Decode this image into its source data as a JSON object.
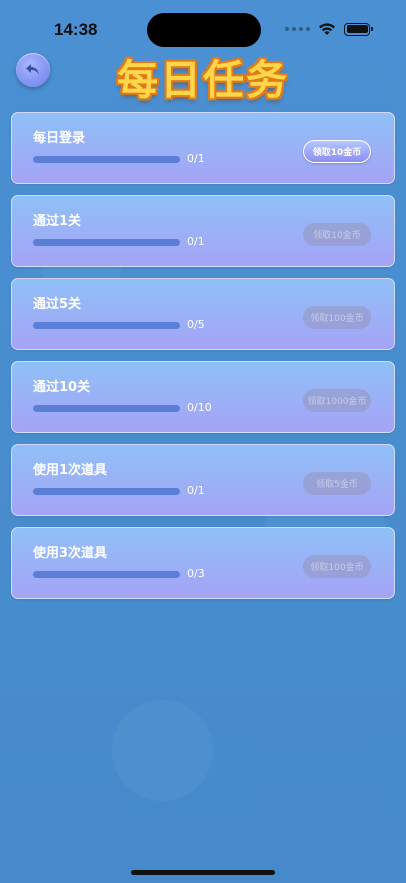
{
  "status_bar": {
    "time": "14:38"
  },
  "header": {
    "title": "每日任务"
  },
  "tasks": [
    {
      "name": "每日登录",
      "progress_text": "0/1",
      "progress": 0,
      "claim_label": "领取10金币",
      "claimable": true
    },
    {
      "name": "通过1关",
      "progress_text": "0/1",
      "progress": 0,
      "claim_label": "领取10金币",
      "claimable": false
    },
    {
      "name": "通过5关",
      "progress_text": "0/5",
      "progress": 0,
      "claim_label": "领取100金币",
      "claimable": false
    },
    {
      "name": "通过10关",
      "progress_text": "0/10",
      "progress": 0,
      "claim_label": "领取1000金币",
      "claimable": false
    },
    {
      "name": "使用1次道具",
      "progress_text": "0/1",
      "progress": 0,
      "claim_label": "领取5金币",
      "claimable": false
    },
    {
      "name": "使用3次道具",
      "progress_text": "0/3",
      "progress": 0,
      "claim_label": "领取100金币",
      "claimable": false
    }
  ],
  "colors": {
    "title": "#ffd54a",
    "background": "#4a8fd0",
    "card": "#a5a3f5"
  }
}
